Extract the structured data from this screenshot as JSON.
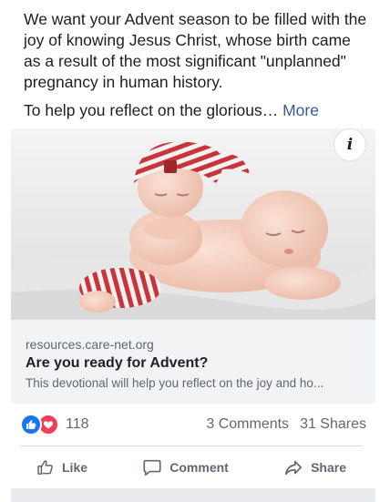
{
  "post": {
    "text_paragraph_1": "We want your Advent season to be filled with the joy of knowing Jesus Christ, whose birth came as a result of the most significant \"unplanned\" pregnancy in human history.",
    "text_paragraph_2": "To help you reflect on the glorious…",
    "more_label": "More"
  },
  "card": {
    "info_label": "i",
    "domain": "resources.care-net.org",
    "headline": "Are you ready for Advent?",
    "description": "This devotional will help you reflect on the joy and ho..."
  },
  "stats": {
    "reaction_count": "118",
    "comments": "3 Comments",
    "shares": "31 Shares"
  },
  "actions": {
    "like": "Like",
    "comment": "Comment",
    "share": "Share"
  },
  "colors": {
    "link": "#385898",
    "like_blue": "#1877f2",
    "love_red": "#f33e58",
    "secondary_text": "#606770"
  },
  "icons": [
    "info-icon",
    "like-reaction-icon",
    "love-reaction-icon",
    "thumbs-up-icon",
    "comment-bubble-icon",
    "share-arrow-icon"
  ]
}
